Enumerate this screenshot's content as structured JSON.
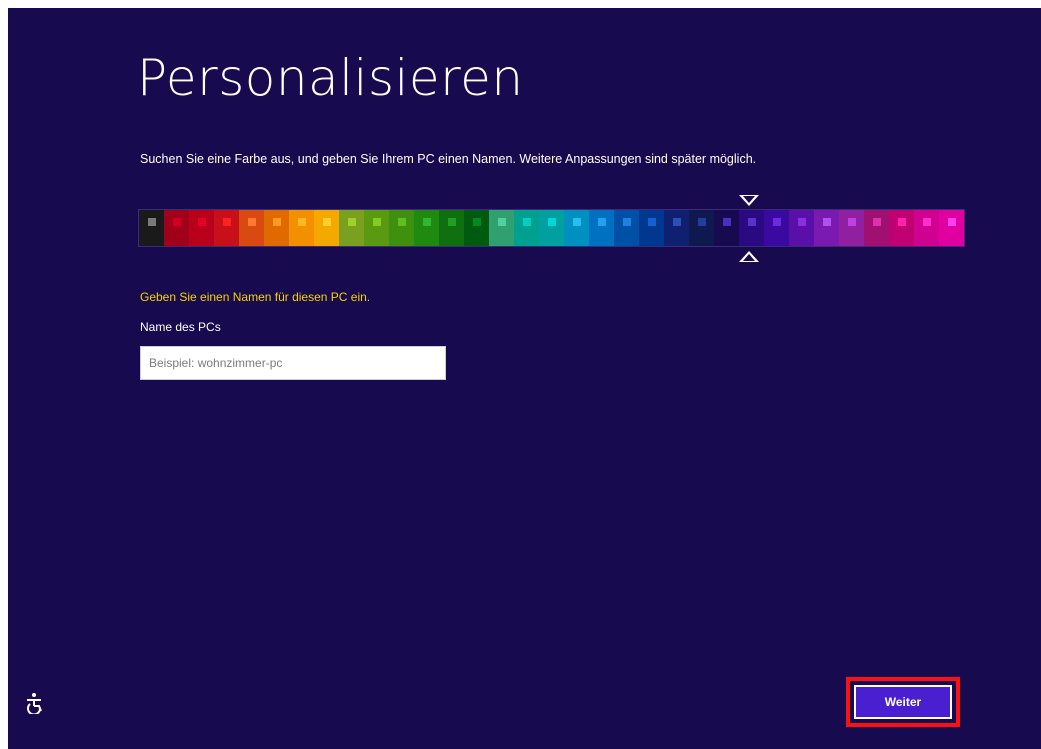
{
  "page": {
    "title": "Personalisieren",
    "subtitle": "Suchen Sie eine Farbe aus, und geben Sie Ihrem PC einen Namen. Weitere Anpassungen sind später möglich.",
    "background_color": "#180a4f"
  },
  "color_slider": {
    "selected_index": 25,
    "swatches": [
      {
        "bg": "#1a1a1a",
        "dot": "#7a7a7a"
      },
      {
        "bg": "#a0001a",
        "dot": "#d2001e"
      },
      {
        "bg": "#b8001a",
        "dot": "#e5002a"
      },
      {
        "bg": "#c8101a",
        "dot": "#ff2020"
      },
      {
        "bg": "#d84a10",
        "dot": "#ff7a30"
      },
      {
        "bg": "#e06a00",
        "dot": "#ff9a20"
      },
      {
        "bg": "#f29000",
        "dot": "#ffb820"
      },
      {
        "bg": "#f4a800",
        "dot": "#ffd030"
      },
      {
        "bg": "#7aa020",
        "dot": "#9fd030"
      },
      {
        "bg": "#5a9a10",
        "dot": "#80cc20"
      },
      {
        "bg": "#409010",
        "dot": "#60c020"
      },
      {
        "bg": "#208a10",
        "dot": "#30b830"
      },
      {
        "bg": "#107010",
        "dot": "#20a020"
      },
      {
        "bg": "#005a10",
        "dot": "#008a20"
      },
      {
        "bg": "#30a070",
        "dot": "#50d0a0"
      },
      {
        "bg": "#00a090",
        "dot": "#00d0c0"
      },
      {
        "bg": "#00a0a0",
        "dot": "#00d8d8"
      },
      {
        "bg": "#0090c0",
        "dot": "#20c0f0"
      },
      {
        "bg": "#0070c0",
        "dot": "#20a0f0"
      },
      {
        "bg": "#0050a8",
        "dot": "#2080e0"
      },
      {
        "bg": "#003890",
        "dot": "#1060d0"
      },
      {
        "bg": "#102070",
        "dot": "#2a50b8"
      },
      {
        "bg": "#101850",
        "dot": "#2040a0"
      },
      {
        "bg": "#180a4f",
        "dot": "#4a30c0"
      },
      {
        "bg": "#2a0a80",
        "dot": "#5a30d0"
      },
      {
        "bg": "#3a0aa0",
        "dot": "#6a2ae0"
      },
      {
        "bg": "#5a10a8",
        "dot": "#8a30e0"
      },
      {
        "bg": "#7a1ab0",
        "dot": "#b050f0"
      },
      {
        "bg": "#9020a0",
        "dot": "#c040e0"
      },
      {
        "bg": "#a01070",
        "dot": "#e030b0"
      },
      {
        "bg": "#c00070",
        "dot": "#ff20b0"
      },
      {
        "bg": "#d00090",
        "dot": "#ff30d0"
      },
      {
        "bg": "#e000a0",
        "dot": "#ff40f0"
      }
    ]
  },
  "pc_name": {
    "hint": "Geben Sie einen Namen für diesen PC ein.",
    "hint_color": "#f5d300",
    "label": "Name des PCs",
    "value": "",
    "placeholder": "Beispiel: wohnzimmer-pc"
  },
  "footer": {
    "ease_of_access_icon": "ease-of-access-icon",
    "next_label": "Weiter",
    "next_highlight_color": "#ff1010",
    "next_bg": "#4a1fd0"
  }
}
